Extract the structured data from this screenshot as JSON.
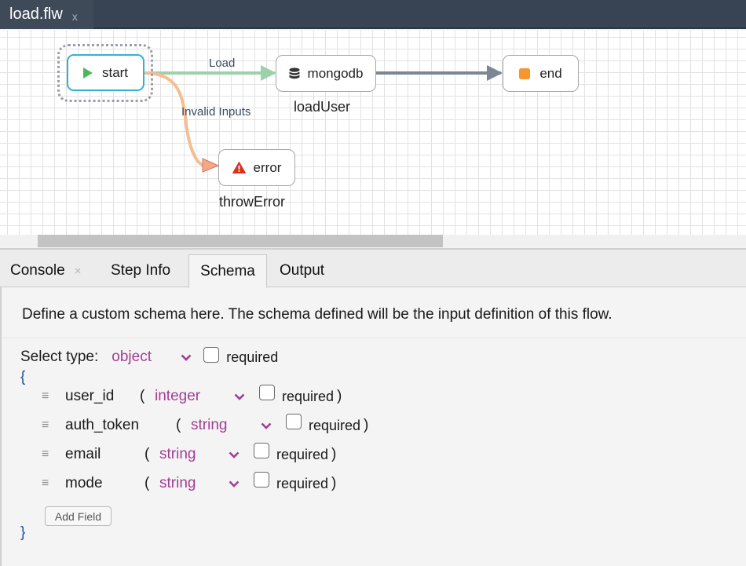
{
  "titlebar": {
    "file_tab": {
      "name": "load.flw",
      "close": "x"
    }
  },
  "flow": {
    "nodes": {
      "start": {
        "label": "start",
        "icon": "play-icon",
        "selected": true
      },
      "mongodb": {
        "label": "mongodb",
        "icon": "database-icon",
        "name": "loadUser"
      },
      "end": {
        "label": "end",
        "icon": "stop-icon"
      },
      "error": {
        "label": "error",
        "icon": "warning-icon",
        "name": "throwError"
      }
    },
    "edges": {
      "load": {
        "from": "start",
        "to": "mongodb",
        "label": "Load",
        "color": "#9fd0ac"
      },
      "invalid": {
        "from": "start",
        "to": "error",
        "label": "Invalid Inputs",
        "color": "#f4be92"
      },
      "finish": {
        "from": "mongodb",
        "to": "end",
        "label": "",
        "color": "#7d8793"
      }
    },
    "colors": {
      "start_border": "#33b1d4",
      "play": "#4cb85c",
      "stop": "#f5962f",
      "warning": "#d8321f"
    }
  },
  "panel": {
    "tabs": [
      {
        "label": "Console",
        "closable": true,
        "close": "×"
      },
      {
        "label": "Step Info"
      },
      {
        "label": "Schema",
        "active": true
      },
      {
        "label": "Output"
      }
    ],
    "schema": {
      "description": "Define a custom schema here. The schema defined will be the input definition of this flow.",
      "select_type_label": "Select type:",
      "select_type_value": "object",
      "required_label": "required",
      "open_brace": "{",
      "close_brace": "}",
      "fields": [
        {
          "name": "user_id",
          "type": "integer",
          "required": false
        },
        {
          "name": "auth_token",
          "type": "string",
          "required": false
        },
        {
          "name": "email",
          "type": "string",
          "required": false
        },
        {
          "name": "mode",
          "type": "string",
          "required": false
        }
      ],
      "paren_open": "(",
      "paren_close": ")",
      "add_field_label": "Add Field"
    }
  }
}
